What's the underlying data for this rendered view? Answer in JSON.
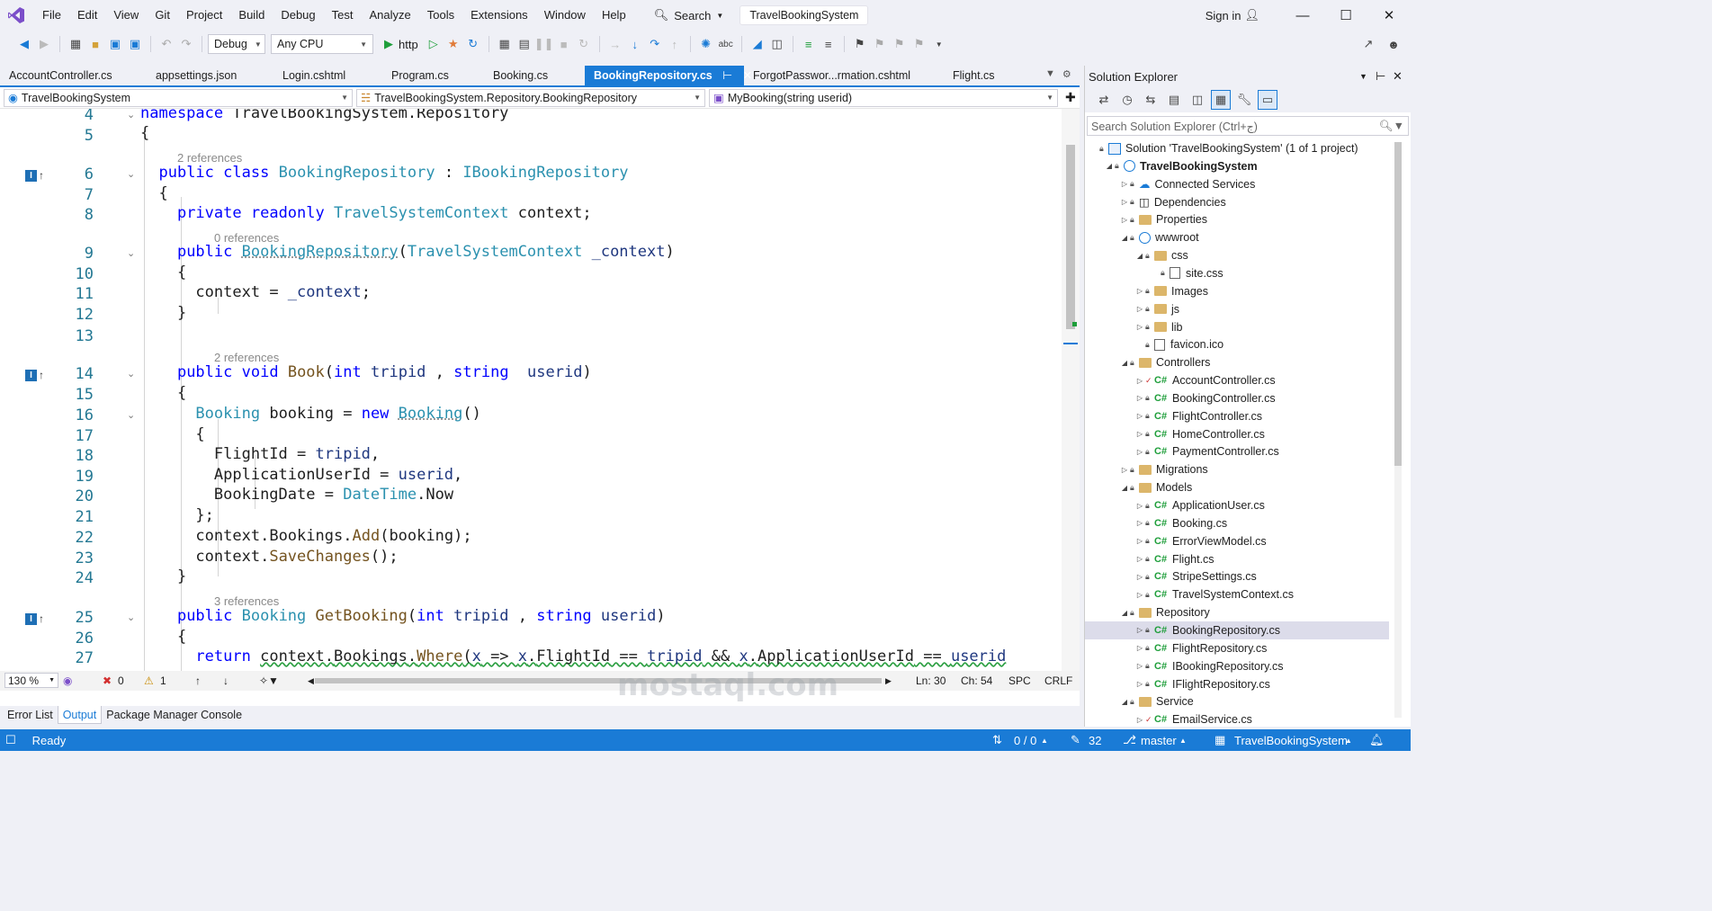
{
  "menu": {
    "items": [
      "File",
      "Edit",
      "View",
      "Git",
      "Project",
      "Build",
      "Debug",
      "Test",
      "Analyze",
      "Tools",
      "Extensions",
      "Window",
      "Help"
    ],
    "search_label": "Search",
    "solution_name": "TravelBookingSystem",
    "signin": "Sign in"
  },
  "toolbar": {
    "config": "Debug",
    "platform": "Any CPU",
    "run_target": "http"
  },
  "tabs": [
    "AccountController.cs",
    "appsettings.json",
    "Login.cshtml",
    "Program.cs",
    "Booking.cs",
    "BookingRepository.cs",
    "ForgotPasswor...rmation.cshtml",
    "Flight.cs"
  ],
  "active_tab": "BookingRepository.cs",
  "navbar": {
    "project": "TravelBookingSystem",
    "class": "TravelBookingSystem.Repository.BookingRepository",
    "member": "MyBooking(string userid)"
  },
  "code": {
    "refs": {
      "r1": "2 references",
      "r2": "0 references",
      "r3": "2 references",
      "r4": "3 references"
    },
    "line_numbers": [
      "4",
      "5",
      "6",
      "7",
      "8",
      "9",
      "10",
      "11",
      "12",
      "13",
      "14",
      "15",
      "16",
      "17",
      "18",
      "19",
      "20",
      "21",
      "22",
      "23",
      "24",
      "25",
      "26",
      "27"
    ],
    "tokens": {
      "namespace": "namespace",
      "public": "public",
      "class": "class",
      "private": "private",
      "readonly": "readonly",
      "void": "void",
      "int": "int",
      "string": "string",
      "new": "new",
      "return": "return",
      "ns_name": "TravelBookingSystem.Repository",
      "BookingRepository": "BookingRepository",
      "IBookingRepository": "IBookingRepository",
      "TravelSystemContext": "TravelSystemContext",
      "context": "context",
      "_context": "_context",
      "Book": "Book",
      "tripid": "tripid",
      "userid": "userid",
      "Booking": "Booking",
      "booking": "booking",
      "FlightId": "FlightId",
      "ApplicationUserId": "ApplicationUserId",
      "BookingDate": "BookingDate",
      "DateTime": "DateTime",
      "Now": "Now",
      "Bookings": "Bookings",
      "Add": "Add",
      "SaveChanges": "SaveChanges",
      "GetBooking": "GetBooking",
      "Where": "Where",
      "x": "x"
    }
  },
  "status_line": {
    "zoom": "130 %",
    "errors": "0",
    "warnings": "1",
    "ln": "Ln: 30",
    "ch": "Ch: 54",
    "spc": "SPC",
    "crlf": "CRLF"
  },
  "bottom_tabs": [
    "Error List",
    "Output",
    "Package Manager Console"
  ],
  "bottom_active": "Output",
  "statusbar": {
    "ready": "Ready",
    "changes": "0 / 0",
    "edits": "32",
    "branch": "master",
    "solution": "TravelBookingSystem"
  },
  "solution_explorer": {
    "title": "Solution Explorer",
    "search_placeholder": "Search Solution Explorer (Ctrl+ج)",
    "items": [
      {
        "label": "Solution 'TravelBookingSystem' (1 of 1 project)",
        "level": 0,
        "kind": "solution",
        "tw": ""
      },
      {
        "label": "TravelBookingSystem",
        "level": 1,
        "kind": "project",
        "tw": "down",
        "bold": true
      },
      {
        "label": "Connected Services",
        "level": 2,
        "kind": "service",
        "tw": "right"
      },
      {
        "label": "Dependencies",
        "level": 2,
        "kind": "deps",
        "tw": "right"
      },
      {
        "label": "Properties",
        "level": 2,
        "kind": "folder",
        "tw": "right"
      },
      {
        "label": "wwwroot",
        "level": 2,
        "kind": "globe",
        "tw": "down"
      },
      {
        "label": "css",
        "level": 3,
        "kind": "folder",
        "tw": "down"
      },
      {
        "label": "site.css",
        "level": 4,
        "kind": "file",
        "tw": ""
      },
      {
        "label": "Images",
        "level": 3,
        "kind": "folder",
        "tw": "right"
      },
      {
        "label": "js",
        "level": 3,
        "kind": "folder",
        "tw": "right"
      },
      {
        "label": "lib",
        "level": 3,
        "kind": "folder",
        "tw": "right"
      },
      {
        "label": "favicon.ico",
        "level": 3,
        "kind": "file",
        "tw": ""
      },
      {
        "label": "Controllers",
        "level": 2,
        "kind": "folder",
        "tw": "down"
      },
      {
        "label": "AccountController.cs",
        "level": 3,
        "kind": "cs",
        "tw": "right",
        "check": true
      },
      {
        "label": "BookingController.cs",
        "level": 3,
        "kind": "cs",
        "tw": "right"
      },
      {
        "label": "FlightController.cs",
        "level": 3,
        "kind": "cs",
        "tw": "right"
      },
      {
        "label": "HomeController.cs",
        "level": 3,
        "kind": "cs",
        "tw": "right"
      },
      {
        "label": "PaymentController.cs",
        "level": 3,
        "kind": "cs",
        "tw": "right"
      },
      {
        "label": "Migrations",
        "level": 2,
        "kind": "folder",
        "tw": "right"
      },
      {
        "label": "Models",
        "level": 2,
        "kind": "folder",
        "tw": "down"
      },
      {
        "label": "ApplicationUser.cs",
        "level": 3,
        "kind": "cs",
        "tw": "right"
      },
      {
        "label": "Booking.cs",
        "level": 3,
        "kind": "cs",
        "tw": "right"
      },
      {
        "label": "ErrorViewModel.cs",
        "level": 3,
        "kind": "cs",
        "tw": "right"
      },
      {
        "label": "Flight.cs",
        "level": 3,
        "kind": "cs",
        "tw": "right"
      },
      {
        "label": "StripeSettings.cs",
        "level": 3,
        "kind": "cs",
        "tw": "right"
      },
      {
        "label": "TravelSystemContext.cs",
        "level": 3,
        "kind": "cs",
        "tw": "right"
      },
      {
        "label": "Repository",
        "level": 2,
        "kind": "folder",
        "tw": "down"
      },
      {
        "label": "BookingRepository.cs",
        "level": 3,
        "kind": "cs",
        "tw": "right",
        "selected": true
      },
      {
        "label": "FlightRepository.cs",
        "level": 3,
        "kind": "cs",
        "tw": "right"
      },
      {
        "label": "IBookingRepository.cs",
        "level": 3,
        "kind": "cs",
        "tw": "right"
      },
      {
        "label": "IFlightRepository.cs",
        "level": 3,
        "kind": "cs",
        "tw": "right"
      },
      {
        "label": "Service",
        "level": 2,
        "kind": "folder",
        "tw": "down"
      },
      {
        "label": "EmailService.cs",
        "level": 3,
        "kind": "cs",
        "tw": "right",
        "check": true
      }
    ]
  },
  "watermark": "mostaql.com",
  "colors": {
    "accent": "#1a7bd6",
    "keyword": "#0000ff",
    "type": "#2b91af",
    "method": "#74531f",
    "param": "#1f377f",
    "linenum": "#237893"
  }
}
